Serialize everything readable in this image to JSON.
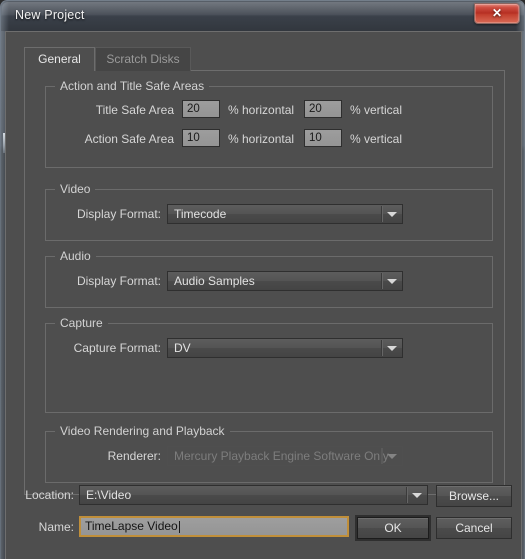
{
  "window": {
    "title": "New Project",
    "close_label": "✕",
    "close_icon": "close-icon"
  },
  "tabs": [
    {
      "label": "General",
      "active": true
    },
    {
      "label": "Scratch Disks",
      "active": false
    }
  ],
  "groups": {
    "safe_areas": {
      "title": "Action and Title Safe Areas",
      "rows": [
        {
          "label": "Title Safe Area",
          "horizontal_value": "20",
          "horizontal_unit": "% horizontal",
          "vertical_value": "20",
          "vertical_unit": "% vertical"
        },
        {
          "label": "Action Safe Area",
          "horizontal_value": "10",
          "horizontal_unit": "% horizontal",
          "vertical_value": "10",
          "vertical_unit": "% vertical"
        }
      ]
    },
    "video": {
      "title": "Video",
      "display_format_label": "Display Format:",
      "display_format_value": "Timecode"
    },
    "audio": {
      "title": "Audio",
      "display_format_label": "Display Format:",
      "display_format_value": "Audio Samples"
    },
    "capture": {
      "title": "Capture",
      "capture_format_label": "Capture Format:",
      "capture_format_value": "DV"
    },
    "rendering": {
      "title": "Video Rendering and Playback",
      "renderer_label": "Renderer:",
      "renderer_value": "Mercury Playback Engine Software Only"
    }
  },
  "footer": {
    "location_label": "Location:",
    "location_value": "E:\\Video",
    "browse_label": "Browse...",
    "name_label": "Name:",
    "name_value": "TimeLapse Video",
    "ok_label": "OK",
    "cancel_label": "Cancel"
  },
  "colors": {
    "dialog_background": "#4e4e4e",
    "titlebar": "#474d56",
    "close_accent": "#b32c20",
    "focus_border": "#c08f3a",
    "text_primary": "#d6d6d6",
    "field_background": "#989898"
  }
}
